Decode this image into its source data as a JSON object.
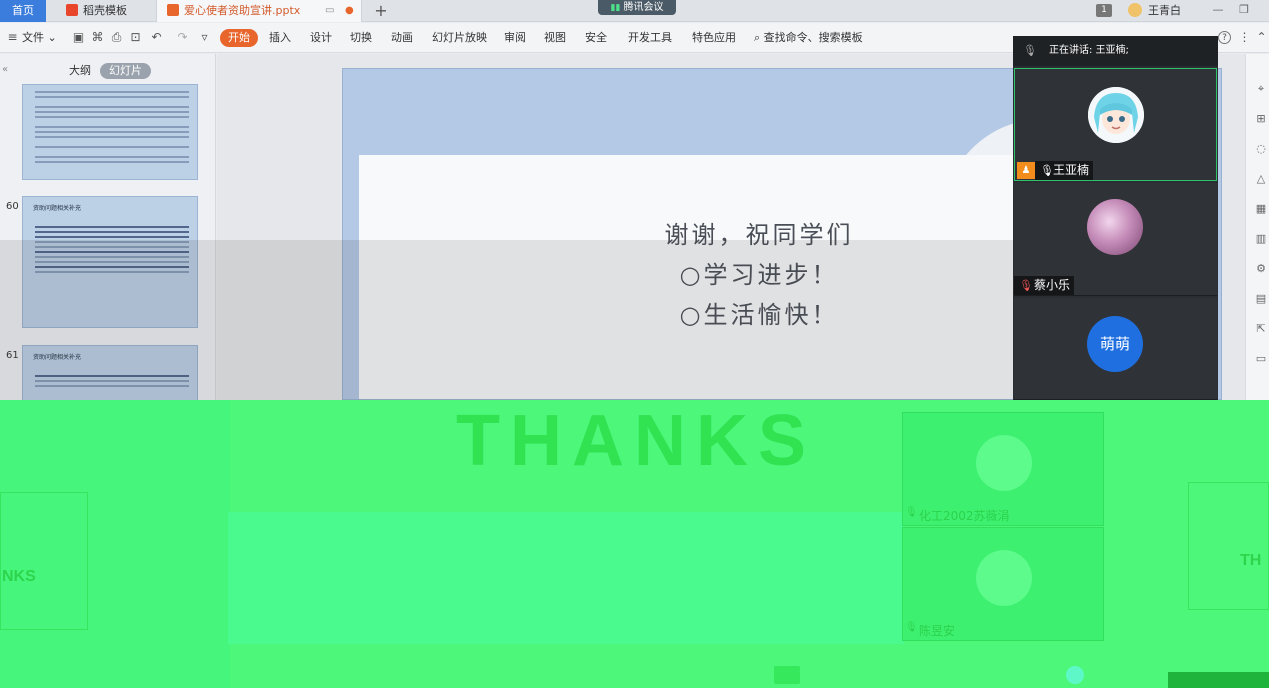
{
  "tabs": {
    "home": "首页",
    "templates": "稻壳模板",
    "doc": "爱心使者资助宣讲.pptx",
    "add": "+"
  },
  "meeting_badge": "腾讯会议",
  "window": {
    "tab_count": "1",
    "user_name": "王青白",
    "minimize": "—",
    "restore": "❐"
  },
  "ribbon": {
    "file_menu": "文件",
    "tabs": [
      "开始",
      "插入",
      "设计",
      "切换",
      "动画",
      "幻灯片放映",
      "审阅",
      "视图",
      "安全",
      "开发工具",
      "特色应用"
    ],
    "search_placeholder": "查找命令、搜索模板",
    "help": "?"
  },
  "left_panel": {
    "tab_outline": "大纲",
    "tab_slides": "幻灯片",
    "slides": [
      {
        "number": "",
        "title": ""
      },
      {
        "number": "60",
        "title": "资助问题相关补充"
      },
      {
        "number": "61",
        "title": "资助问题相关补充"
      }
    ]
  },
  "slide": {
    "line1": "谢谢，祝同学们",
    "line2": "○学习进步！",
    "line3": "○生活愉快！",
    "watermark": "THANKS"
  },
  "meeting": {
    "speaking_label": "正在讲话: 王亚楠;",
    "participants": [
      {
        "name": "王亚楠",
        "host": true
      },
      {
        "name": "蔡小乐",
        "host": false
      },
      {
        "name": "萌萌",
        "avatar_text": "萌萌",
        "host": false
      }
    ],
    "ghost_participants": [
      "化工2002苏薇涓",
      "陈昱安"
    ]
  },
  "colors": {
    "accent": "#e8652b",
    "home_tab": "#3b7ddd",
    "speaking_border": "#2fc16b",
    "host_badge": "#f28c1c",
    "glitch_green": "#4cf77a"
  }
}
